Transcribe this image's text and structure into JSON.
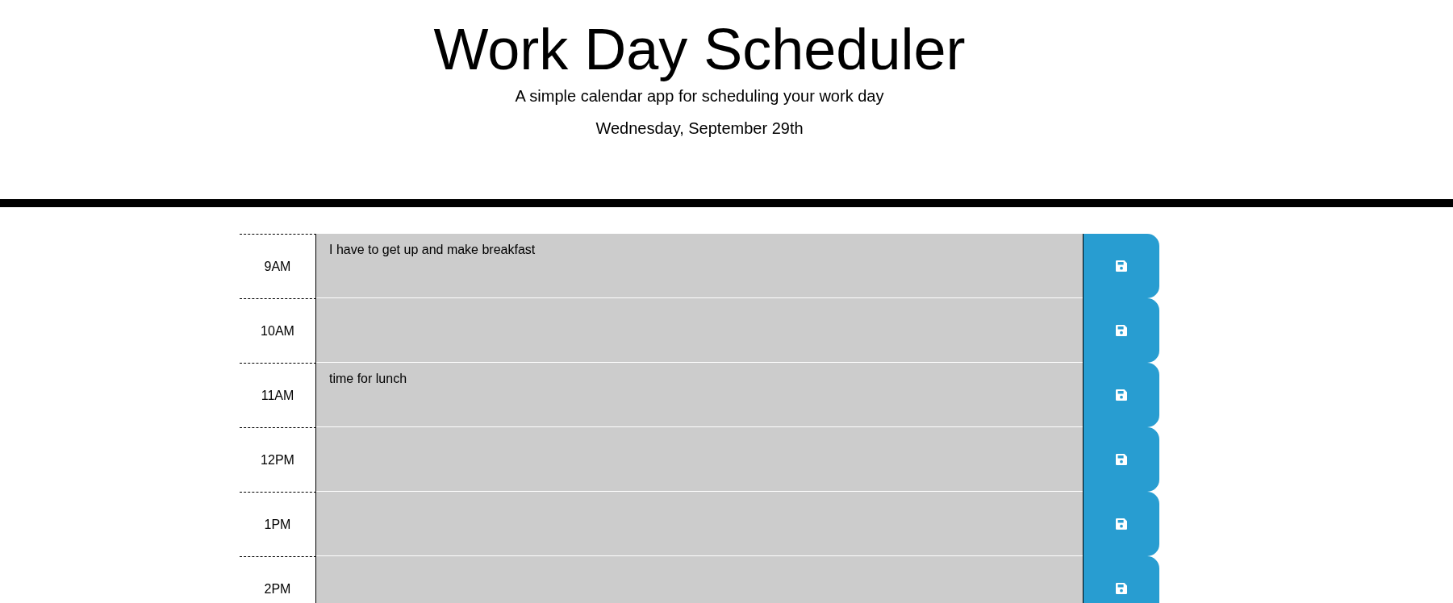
{
  "header": {
    "title": "Work Day Scheduler",
    "subtitle": "A simple calendar app for scheduling your work day",
    "date": "Wednesday, September 29th"
  },
  "time_blocks": [
    {
      "hour": "9AM",
      "value": "I have to get up and make breakfast"
    },
    {
      "hour": "10AM"
    },
    {
      "hour": "11AM",
      "value": "time for lunch"
    },
    {
      "hour": "12PM"
    },
    {
      "hour": "1PM"
    },
    {
      "hour": "2PM"
    }
  ]
}
